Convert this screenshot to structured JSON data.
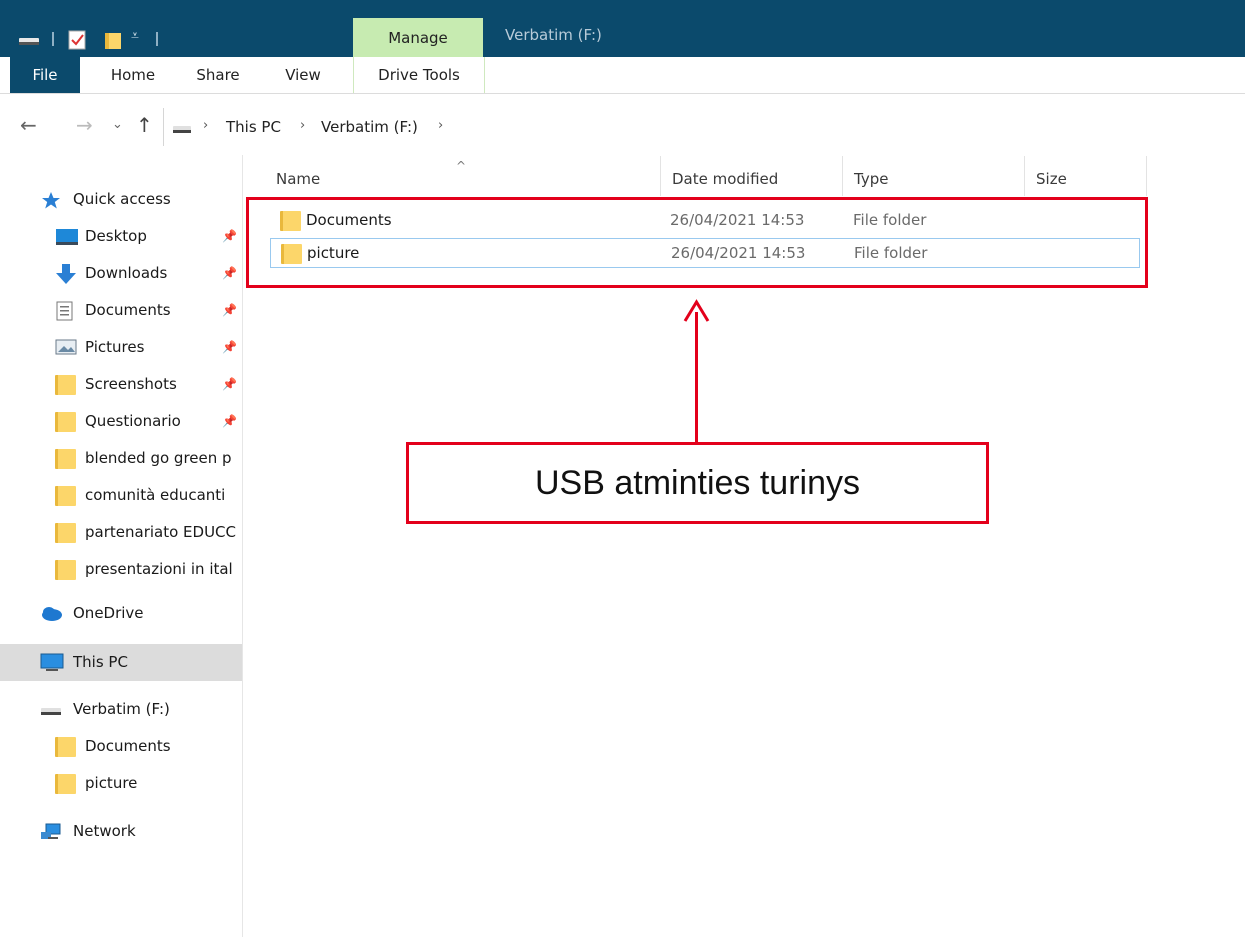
{
  "window": {
    "title": "Verbatim (F:)",
    "context_tab": "Manage"
  },
  "ribbon": {
    "tabs": [
      "File",
      "Home",
      "Share",
      "View",
      "Drive Tools"
    ]
  },
  "breadcrumb": [
    "This PC",
    "Verbatim (F:)"
  ],
  "nav": {
    "quick_access": "Quick access",
    "items": [
      {
        "label": "Desktop",
        "pinned": true
      },
      {
        "label": "Downloads",
        "pinned": true
      },
      {
        "label": "Documents",
        "pinned": true
      },
      {
        "label": "Pictures",
        "pinned": true
      },
      {
        "label": "Screenshots",
        "pinned": true
      },
      {
        "label": "Questionario",
        "pinned": true
      },
      {
        "label": "blended go green p",
        "pinned": false
      },
      {
        "label": "comunità educanti",
        "pinned": false
      },
      {
        "label": "partenariato EDUCC",
        "pinned": false
      },
      {
        "label": "presentazioni in ital",
        "pinned": false
      }
    ],
    "onedrive": "OneDrive",
    "this_pc": "This PC",
    "drive": "Verbatim (F:)",
    "drive_children": [
      "Documents",
      "picture"
    ],
    "network": "Network"
  },
  "columns": {
    "name": "Name",
    "date": "Date modified",
    "type": "Type",
    "size": "Size"
  },
  "files": [
    {
      "name": "Documents",
      "date": "26/04/2021 14:53",
      "type": "File folder"
    },
    {
      "name": "picture",
      "date": "26/04/2021 14:53",
      "type": "File folder"
    }
  ],
  "annotation": {
    "callout": "USB atminties turinys",
    "color": "#e3001b"
  },
  "colors": {
    "titlebar": "#0b4a6c",
    "context_tab": "#c7ebb1",
    "folder": "#fcd66a"
  }
}
